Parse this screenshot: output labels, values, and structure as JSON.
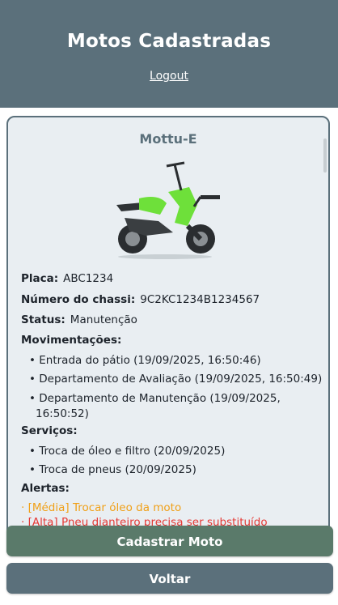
{
  "header": {
    "title": "Motos Cadastradas",
    "logout_label": "Logout"
  },
  "moto": {
    "name": "Mottu-E",
    "placa_label": "Placa:",
    "placa": "ABC1234",
    "chassi_label": "Número do chassi:",
    "chassi": "9C2KC1234B1234567",
    "status_label": "Status:",
    "status": "Manutenção",
    "movimentacoes_label": "Movimentações:",
    "movimentacoes": [
      "• Entrada do pátio (19/09/2025, 16:50:46)",
      "• Departamento de Avaliação (19/09/2025, 16:50:49)",
      "• Departamento de Manutenção (19/09/2025,",
      "16:50:52)"
    ],
    "servicos_label": "Serviços:",
    "servicos": [
      "• Troca de óleo e filtro (20/09/2025)",
      "• Troca de pneus (20/09/2025)"
    ],
    "alertas_label": "Alertas:",
    "alertas": [
      "· [Média] Trocar óleo da moto",
      "· [Alta] Pneu dianteiro precisa ser substituído"
    ]
  },
  "buttons": {
    "cadastrar": "Cadastrar Moto",
    "voltar": "Voltar"
  },
  "colors": {
    "header_bg": "#5b707b",
    "card_bg": "#e9eef2",
    "cadastrar_bg": "#5a7a6a",
    "voltar_bg": "#5b707b",
    "alert_media": "#f0a018",
    "alert_alta": "#e53935"
  }
}
